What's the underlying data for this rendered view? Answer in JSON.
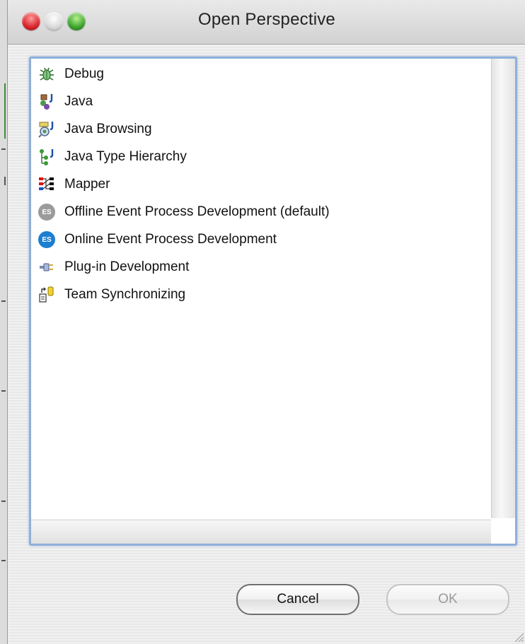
{
  "window": {
    "title": "Open Perspective"
  },
  "perspectives": [
    {
      "label": "Debug",
      "icon": "debug-icon"
    },
    {
      "label": "Java",
      "icon": "java-icon"
    },
    {
      "label": "Java Browsing",
      "icon": "java-browsing-icon"
    },
    {
      "label": "Java Type Hierarchy",
      "icon": "java-type-hierarchy-icon"
    },
    {
      "label": "Mapper",
      "icon": "mapper-icon"
    },
    {
      "label": "Offline Event Process Development (default)",
      "icon": "es-gray-icon"
    },
    {
      "label": "Online Event Process Development",
      "icon": "es-blue-icon"
    },
    {
      "label": "Plug-in Development",
      "icon": "plugin-icon"
    },
    {
      "label": "Team Synchronizing",
      "icon": "team-sync-icon"
    }
  ],
  "buttons": {
    "cancel": "Cancel",
    "ok": "OK"
  },
  "icons": {
    "es_text": "ES"
  },
  "colors": {
    "es_blue": "#1d7fd0",
    "es_gray": "#9b9b9b",
    "focus_ring": "#8fb0d9"
  }
}
